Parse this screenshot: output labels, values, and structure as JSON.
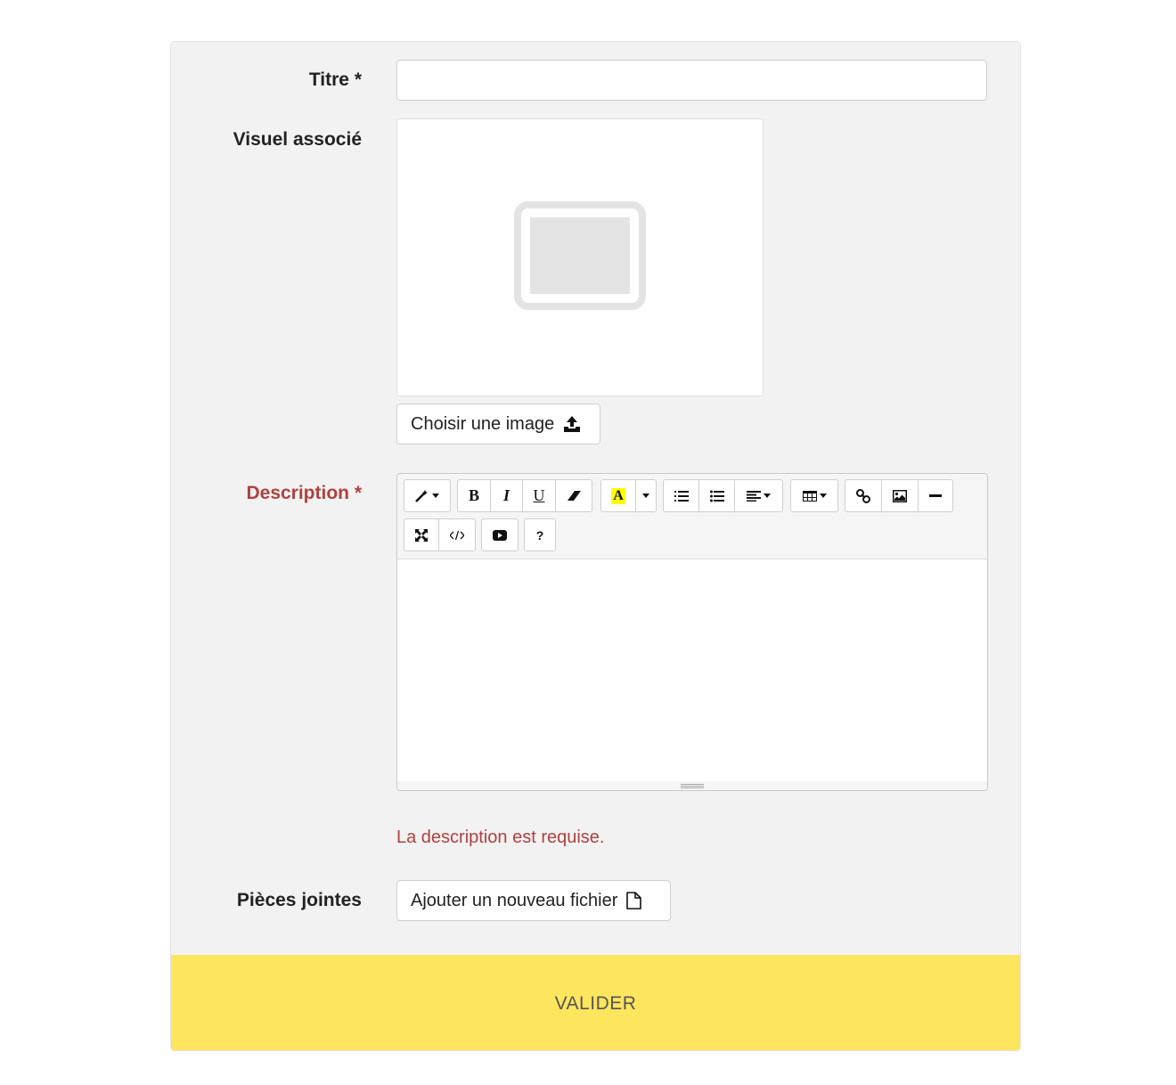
{
  "form": {
    "title_label": "Titre *",
    "title_value": "",
    "visual_label": "Visuel associé",
    "choose_image_label": "Choisir une image",
    "description_label": "Description *",
    "description_error": "La description est requise.",
    "attachments_label": "Pièces jointes",
    "add_file_label": "Ajouter un nouveau fichier",
    "submit_label": "VALIDER"
  },
  "editor": {
    "toolbar_row1": [
      "magic-style",
      "bold",
      "italic",
      "underline",
      "eraser",
      "highlight-color",
      "color-dropdown",
      "ordered-list",
      "unordered-list",
      "paragraph-align",
      "table",
      "link",
      "picture",
      "hr"
    ],
    "toolbar_row2": [
      "fullscreen",
      "codeview",
      "video",
      "help"
    ],
    "bold_glyph": "B",
    "italic_glyph": "I",
    "underline_glyph": "U",
    "color_glyph": "A",
    "help_glyph": "?",
    "content": ""
  },
  "colors": {
    "error": "#b0413e",
    "submit_bg": "#fde55e",
    "highlight": "#ffff00"
  }
}
